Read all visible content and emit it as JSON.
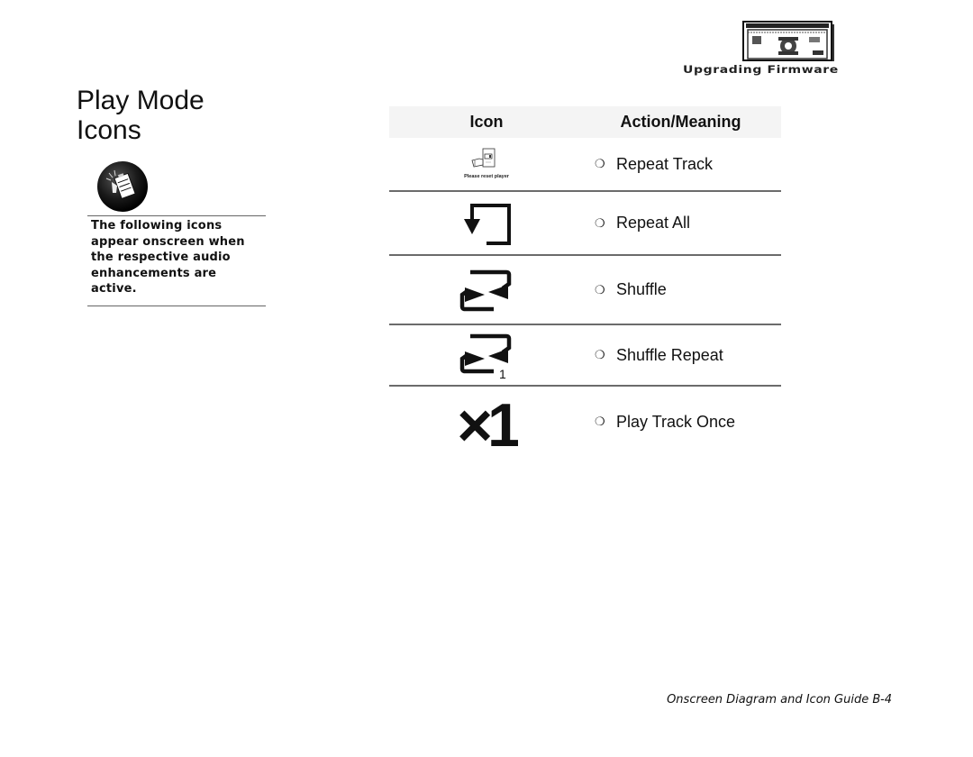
{
  "header": {
    "logo_icon": "firmware-window-icon",
    "logo_caption": "Upgrading Firmware"
  },
  "page": {
    "title_line1": "Play Mode",
    "title_line2": "Icons"
  },
  "note": {
    "icon": "note-clipboard-icon",
    "text": "The following icons appear onscreen when the respective audio enhancements are active."
  },
  "table": {
    "columns": [
      "Icon",
      "Action/Meaning"
    ],
    "bullet": "❍",
    "rows": [
      {
        "icon": "repeat-track-icon",
        "icon_caption": "Please reset player",
        "action": "Repeat Track"
      },
      {
        "icon": "repeat-all-icon",
        "action": "Repeat All"
      },
      {
        "icon": "shuffle-icon",
        "action": "Shuffle"
      },
      {
        "icon": "shuffle-repeat-icon",
        "icon_badge": "1",
        "action": "Shuffle Repeat"
      },
      {
        "icon": "play-track-once-icon",
        "icon_label": "×1",
        "action": "Play Track Once"
      }
    ]
  },
  "footer": {
    "text": "Onscreen Diagram and Icon Guide B-4"
  }
}
